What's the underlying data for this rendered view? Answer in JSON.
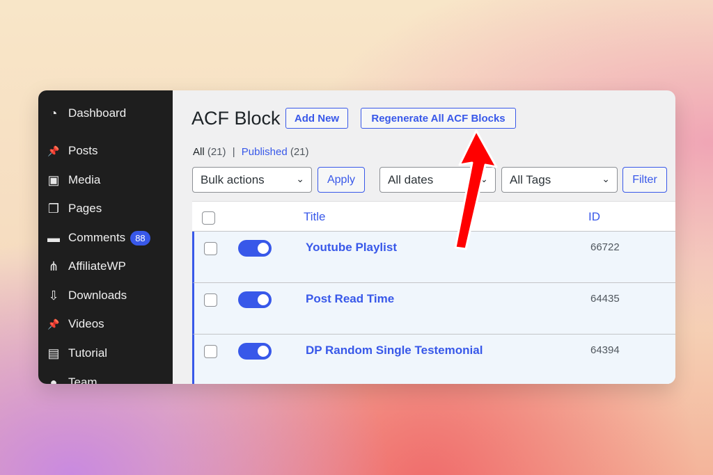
{
  "sidebar": {
    "items": [
      {
        "label": "Dashboard",
        "icon": "dashboard-icon",
        "glyph": "◔"
      },
      {
        "label": "Posts",
        "icon": "pin-icon",
        "glyph": "📌"
      },
      {
        "label": "Media",
        "icon": "media-icon",
        "glyph": "▣"
      },
      {
        "label": "Pages",
        "icon": "pages-icon",
        "glyph": "❐"
      },
      {
        "label": "Comments",
        "icon": "comment-icon",
        "glyph": "▬",
        "badge": "88"
      },
      {
        "label": "AffiliateWP",
        "icon": "affiliate-icon",
        "glyph": "⋔"
      },
      {
        "label": "Downloads",
        "icon": "download-icon",
        "glyph": "⇩"
      },
      {
        "label": "Videos",
        "icon": "pin-icon",
        "glyph": "📌"
      },
      {
        "label": "Tutorial",
        "icon": "chart-icon",
        "glyph": "▤"
      },
      {
        "label": "Team",
        "icon": "user-icon",
        "glyph": "●"
      }
    ]
  },
  "header": {
    "title": "ACF Block",
    "add_new": "Add New",
    "regenerate": "Regenerate All ACF Blocks"
  },
  "filters": {
    "all": "All",
    "all_count": "(21)",
    "sep": "|",
    "published": "Published",
    "published_count": "(21)",
    "bulk": "Bulk actions",
    "apply": "Apply",
    "dates": "All dates",
    "tags": "All Tags",
    "filter": "Filter"
  },
  "table": {
    "columns": {
      "title": "Title",
      "id": "ID"
    },
    "rows": [
      {
        "title": "Youtube Playlist",
        "id": "66722",
        "enabled": true
      },
      {
        "title": "Post Read Time",
        "id": "64435",
        "enabled": true
      },
      {
        "title": "DP Random Single Testemonial",
        "id": "64394",
        "enabled": true
      }
    ]
  },
  "colors": {
    "accent": "#3858e9",
    "sidebar": "#1e1e1e",
    "arrow": "#ff0000"
  }
}
